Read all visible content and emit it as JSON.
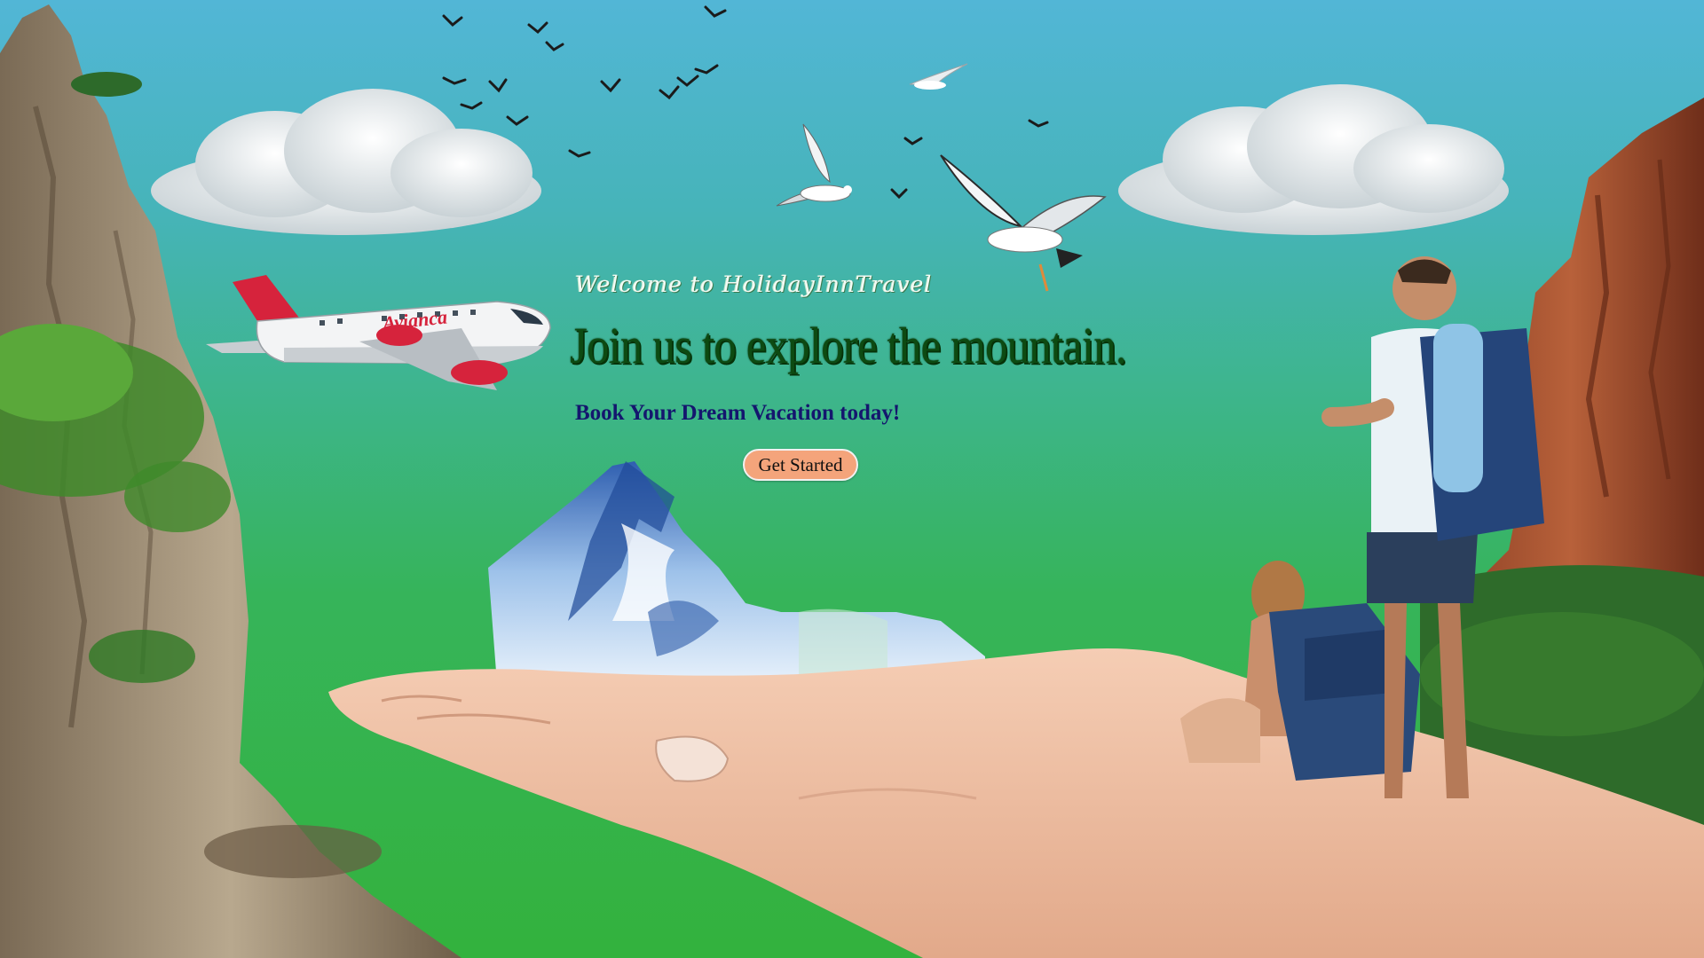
{
  "hero": {
    "welcome_text": "Welcome to HolidayInnTravel",
    "headline": "Join us to explore the mountain.",
    "tagline": "Book Your Dream Vacation today!",
    "cta_label": "Get Started"
  },
  "airplane": {
    "livery_text": "Avianca"
  },
  "colors": {
    "sky_top": "#52b6d6",
    "sky_bottom": "#33b23d",
    "headline": "#0d4a12",
    "tagline": "#14166e",
    "cta_background": "#f4a47b",
    "airplane_accent": "#d6233c"
  }
}
